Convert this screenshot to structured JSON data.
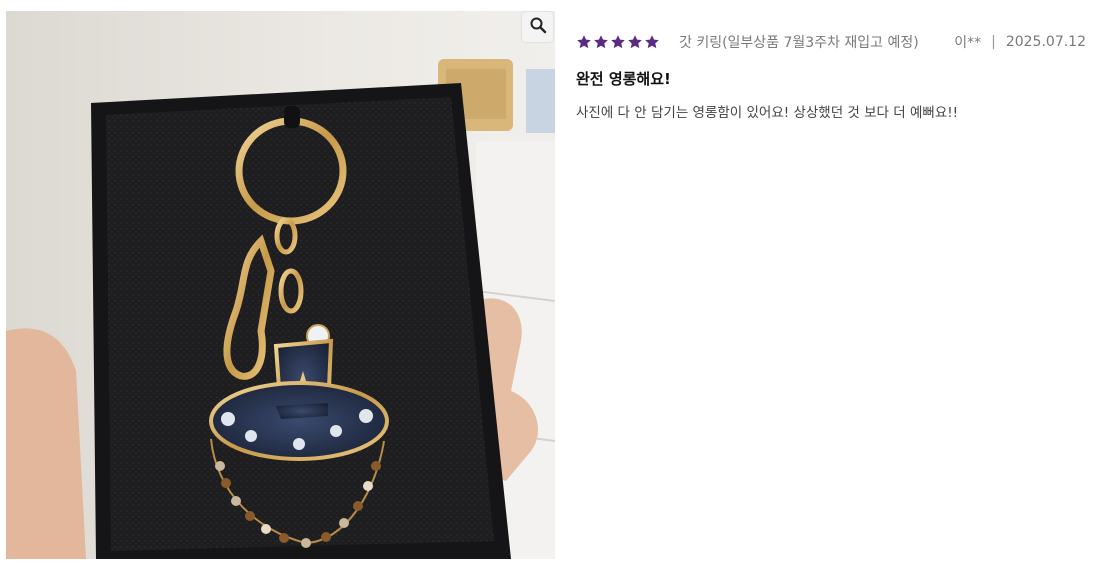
{
  "review": {
    "rating": 5,
    "rating_max": 5,
    "star_color": "#5b2a86",
    "option": "갓 키링(일부상품 7월3주차 재입고 예정)",
    "author": "이**",
    "separator": "|",
    "date": "2025.07.12",
    "title": "완전 영롱해요!",
    "body": "사진에 다 안 담기는 영롱함이 있어요! 상상했던 것 보다 더 예뻐요!!"
  },
  "photo": {
    "zoom_icon": "magnifier-icon"
  }
}
